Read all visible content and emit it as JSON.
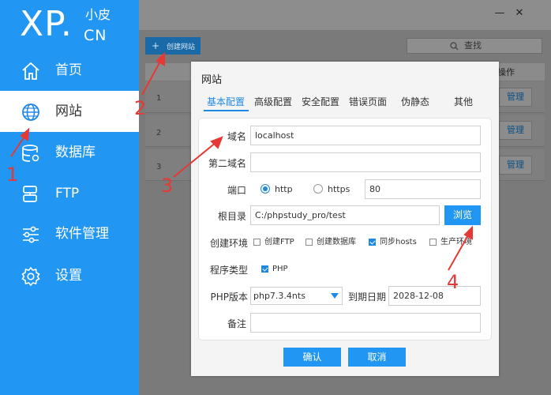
{
  "logo": {
    "main": "XP.",
    "small": "小皮",
    "cn": "CN"
  },
  "sidebar": {
    "items": [
      {
        "label": "首页",
        "icon": "home-icon"
      },
      {
        "label": "网站",
        "icon": "globe-icon",
        "active": true
      },
      {
        "label": "数据库",
        "icon": "database-icon"
      },
      {
        "label": "FTP",
        "icon": "ftp-icon"
      },
      {
        "label": "软件管理",
        "icon": "sliders-icon"
      },
      {
        "label": "设置",
        "icon": "gear-icon"
      }
    ]
  },
  "window": {
    "minimize": "—",
    "close": "✕"
  },
  "toolbar": {
    "create_label": "创建网站",
    "create_icon": "+",
    "search_label": "查找"
  },
  "table": {
    "op_header": "操作",
    "rows": [
      {
        "no": "1",
        "action": "管理"
      },
      {
        "no": "2",
        "action": "管理"
      },
      {
        "no": "3",
        "action": "管理"
      }
    ]
  },
  "dialog": {
    "title": "网站",
    "tabs": [
      "基本配置",
      "高级配置",
      "安全配置",
      "错误页面",
      "伪静态",
      "其他"
    ],
    "active_tab": 0,
    "fields": {
      "domain_label": "域名",
      "domain_value": "localhost",
      "second_domain_label": "第二域名",
      "second_domain_value": "",
      "port_label": "端口",
      "http_label": "http",
      "https_label": "https",
      "port_value": "80",
      "root_label": "根目录",
      "root_value": "C:/phpstudy_pro/test",
      "browse_label": "浏览",
      "env_label": "创建环境",
      "env_options": [
        {
          "label": "创建FTP",
          "checked": false
        },
        {
          "label": "创建数据库",
          "checked": false
        },
        {
          "label": "同步hosts",
          "checked": true
        },
        {
          "label": "生产环境",
          "checked": false
        }
      ],
      "program_label": "程序类型",
      "program_option": "PHP",
      "php_version_label": "PHP版本",
      "php_version_value": "php7.3.4nts",
      "expire_label": "到期日期",
      "expire_value": "2028-12-08",
      "note_label": "备注",
      "note_value": ""
    },
    "confirm_label": "确认",
    "cancel_label": "取消"
  },
  "annotations": {
    "a1": "1",
    "a2": "2",
    "a3": "3",
    "a4": "4",
    "color": "#e53935"
  },
  "colors": {
    "accent": "#2196f3",
    "sidebar": "#2196f3"
  }
}
